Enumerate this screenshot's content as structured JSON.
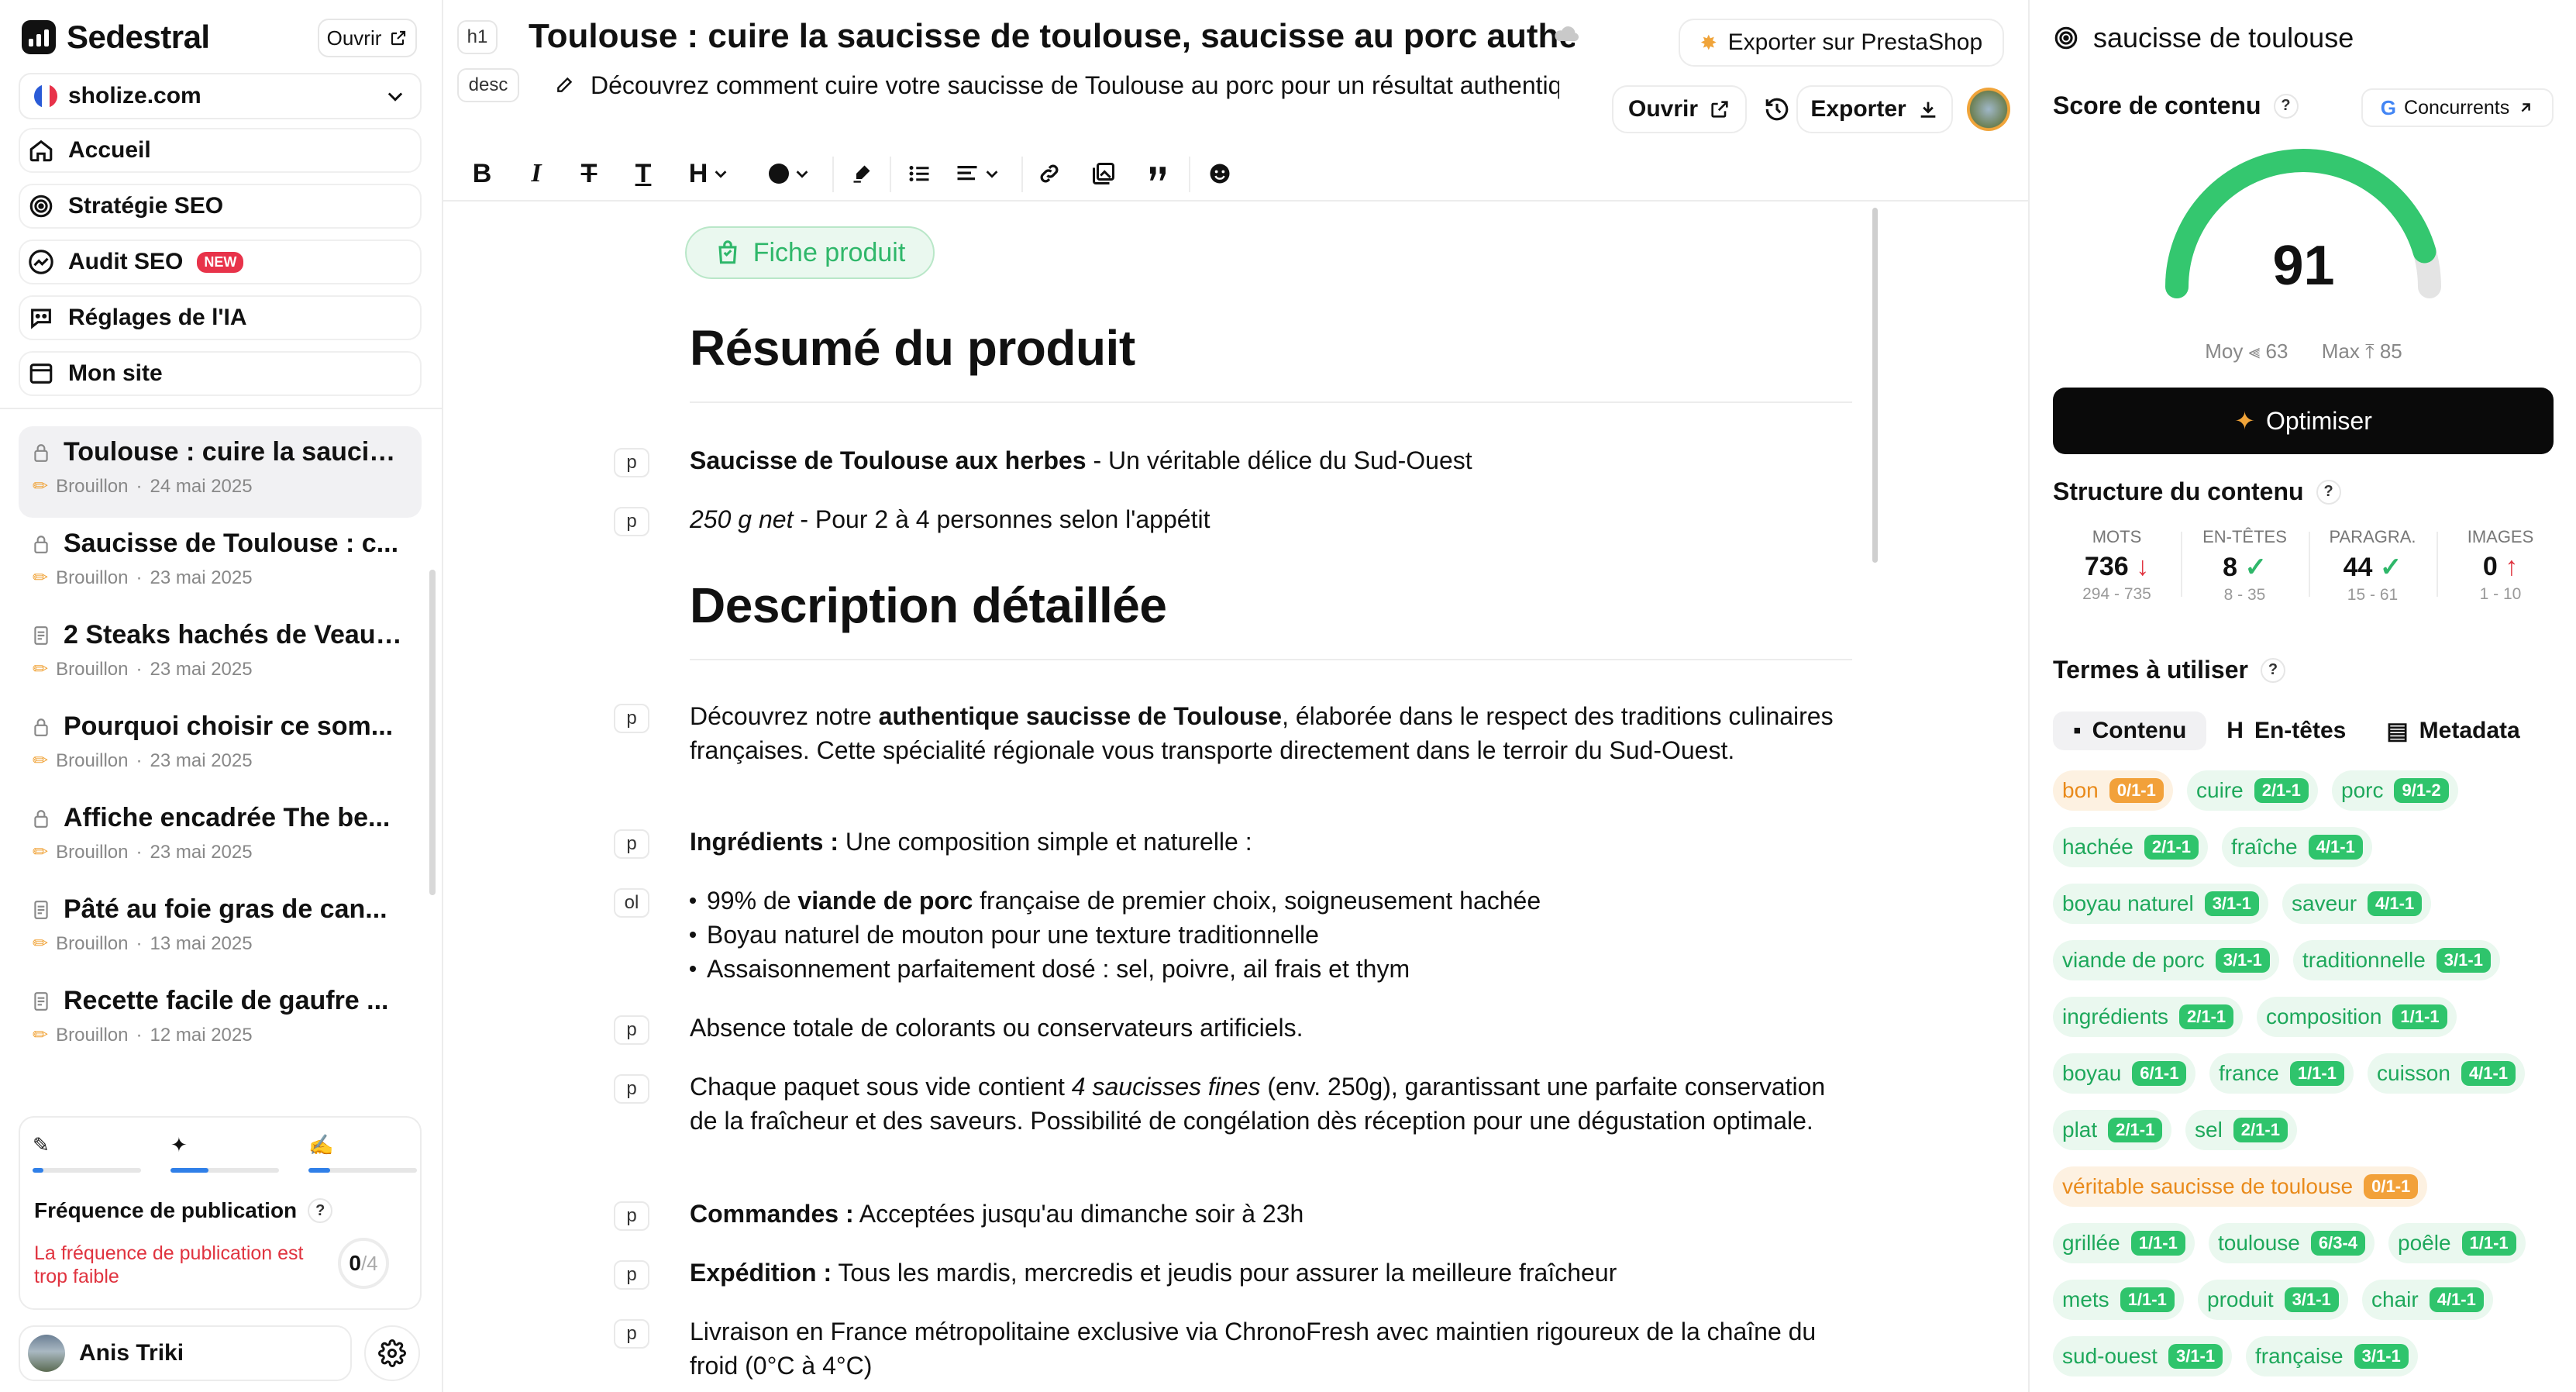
{
  "sidebar": {
    "brand": "Sedestral",
    "open_label": "Ouvrir",
    "site": "sholize.com",
    "nav": [
      {
        "label": "Accueil"
      },
      {
        "label": "Stratégie SEO"
      },
      {
        "label": "Audit SEO",
        "badge": "NEW"
      },
      {
        "label": "Réglages de l'IA"
      },
      {
        "label": "Mon site"
      }
    ],
    "documents": [
      {
        "title": "Toulouse : cuire la saucis...",
        "status": "Brouillon",
        "date": "24 mai 2025",
        "active": true
      },
      {
        "title": "Saucisse de Toulouse : c...",
        "status": "Brouillon",
        "date": "23 mai 2025"
      },
      {
        "title": "2 Steaks hachés de Veau ...",
        "status": "Brouillon",
        "date": "23 mai 2025"
      },
      {
        "title": "Pourquoi choisir ce som...",
        "status": "Brouillon",
        "date": "23 mai 2025"
      },
      {
        "title": "Affiche encadrée The be...",
        "status": "Brouillon",
        "date": "23 mai 2025"
      },
      {
        "title": "Pâté au foie gras de can...",
        "status": "Brouillon",
        "date": "13 mai 2025"
      },
      {
        "title": "Recette facile de gaufre ...",
        "status": "Brouillon",
        "date": "12 mai 2025"
      }
    ],
    "frequency": {
      "title": "Fréquence de publication",
      "help": "?",
      "warning": "La fréquence de publication est trop faible",
      "count": "0",
      "total": "/4",
      "progress": [
        0.1,
        0.35,
        0.2
      ]
    },
    "user": {
      "name": "Anis Triki"
    }
  },
  "editor": {
    "h1_tag": "h1",
    "desc_tag": "desc",
    "title": "Toulouse : cuire la saucisse de toulouse, saucisse au porc authentique",
    "description": "Découvrez comment cuire votre saucisse de Toulouse au porc pour un résultat authentique",
    "export_presta": "Exporter sur PrestaShop",
    "open_label": "Ouvrir",
    "export_label": "Exporter",
    "toolbar": {
      "heading": "H"
    },
    "badge": "Fiche produit",
    "h_resume": "Résumé du produit",
    "h_description": "Description détaillée",
    "tags": {
      "p": "p",
      "ol": "ol"
    },
    "p1_bold": "Saucisse de Toulouse aux herbes",
    "p1_rest": " - Un véritable délice du Sud-Ouest",
    "p2_italic": "250 g net",
    "p2_rest": " - Pour 2 à 4 personnes selon l'appétit",
    "p3_a": "Découvrez notre ",
    "p3_bold": "authentique saucisse de Toulouse",
    "p3_b": ", élaborée dans le respect des traditions culinaires françaises. Cette spécialité régionale vous transporte directement dans le terroir du Sud-Ouest.",
    "p4_bold": "Ingrédients :",
    "p4_rest": " Une composition simple et naturelle :",
    "li1_a": "99% de ",
    "li1_bold": "viande de porc",
    "li1_b": " française de premier choix, soigneusement hachée",
    "li2": "Boyau naturel de mouton pour une texture traditionnelle",
    "li3": "Assaisonnement parfaitement dosé : sel, poivre, ail frais et thym",
    "p5": "Absence totale de colorants ou conservateurs artificiels.",
    "p6_a": "Chaque paquet sous vide contient ",
    "p6_italic": "4 saucisses fines",
    "p6_b": " (env. 250g), garantissant une parfaite conservation de la fraîcheur et des saveurs. Possibilité de congélation dès réception pour une dégustation optimale.",
    "p7_bold": "Commandes :",
    "p7_rest": " Acceptées jusqu'au dimanche soir à 23h",
    "p8_bold": "Expédition :",
    "p8_rest": " Tous les mardis, mercredis et jeudis pour assurer la meilleure fraîcheur",
    "p9": "Livraison en France métropolitaine exclusive via ChronoFresh avec maintien rigoureux de la chaîne du froid (0°C à 4°C)"
  },
  "panel": {
    "keyword": "saucisse de toulouse",
    "score_title": "Score de contenu",
    "help": "?",
    "competitors": "Concurrents",
    "score": 91,
    "score_max": 100,
    "moy_label": "Moy",
    "moy": "63",
    "max_label": "Max",
    "max": "85",
    "optimize": "Optimiser",
    "structure_title": "Structure du contenu",
    "stats": [
      {
        "label": "MOTS",
        "value": "736",
        "range": "294 - 735",
        "status": "down"
      },
      {
        "label": "EN-TÊTES",
        "value": "8",
        "range": "8 - 35",
        "status": "ok"
      },
      {
        "label": "PARAGRA.",
        "value": "44",
        "range": "15 - 61",
        "status": "ok"
      },
      {
        "label": "IMAGES",
        "value": "0",
        "range": "1 - 10",
        "status": "up"
      }
    ],
    "terms_title": "Termes à utiliser",
    "tabs": [
      {
        "label": "Contenu",
        "active": true
      },
      {
        "label": "En-têtes"
      },
      {
        "label": "Metadata"
      }
    ],
    "terms": [
      {
        "t": "bon",
        "c": "0/1-1",
        "warn": true
      },
      {
        "t": "cuire",
        "c": "2/1-1"
      },
      {
        "t": "porc",
        "c": "9/1-2"
      },
      {
        "t": "hachée",
        "c": "2/1-1"
      },
      {
        "t": "fraîche",
        "c": "4/1-1"
      },
      {
        "t": "boyau naturel",
        "c": "3/1-1"
      },
      {
        "t": "saveur",
        "c": "4/1-1"
      },
      {
        "t": "viande de porc",
        "c": "3/1-1"
      },
      {
        "t": "traditionnelle",
        "c": "3/1-1"
      },
      {
        "t": "ingrédients",
        "c": "2/1-1"
      },
      {
        "t": "composition",
        "c": "1/1-1"
      },
      {
        "t": "boyau",
        "c": "6/1-1"
      },
      {
        "t": "france",
        "c": "1/1-1"
      },
      {
        "t": "cuisson",
        "c": "4/1-1"
      },
      {
        "t": "plat",
        "c": "2/1-1"
      },
      {
        "t": "sel",
        "c": "2/1-1"
      },
      {
        "t": "véritable saucisse de toulouse",
        "c": "0/1-1",
        "warn": true
      },
      {
        "t": "grillée",
        "c": "1/1-1"
      },
      {
        "t": "toulouse",
        "c": "6/3-4"
      },
      {
        "t": "poêle",
        "c": "1/1-1"
      },
      {
        "t": "mets",
        "c": "1/1-1"
      },
      {
        "t": "produit",
        "c": "3/1-1"
      },
      {
        "t": "chair",
        "c": "4/1-1"
      },
      {
        "t": "sud-ouest",
        "c": "3/1-1"
      },
      {
        "t": "française",
        "c": "3/1-1"
      }
    ]
  }
}
